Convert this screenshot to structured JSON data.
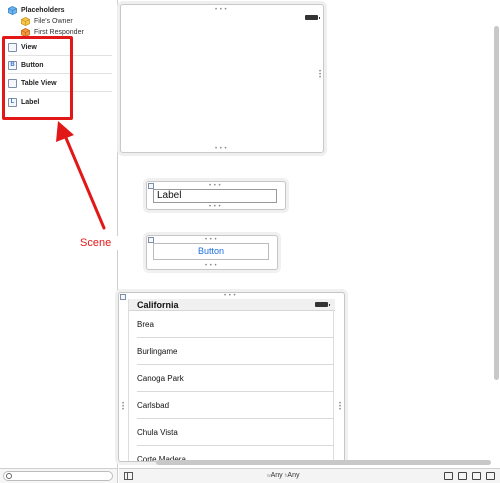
{
  "outline": {
    "placeholders_label": "Placeholders",
    "files_owner": "File's Owner",
    "first_responder": "First Responder",
    "scene_items": [
      {
        "label": "View",
        "icon": "view-icon",
        "glyph": ""
      },
      {
        "label": "Button",
        "icon": "button-icon",
        "glyph": "B"
      },
      {
        "label": "Table View",
        "icon": "table-view-icon",
        "glyph": ""
      },
      {
        "label": "Label",
        "icon": "label-icon",
        "glyph": "L"
      }
    ]
  },
  "annotation": {
    "caption": "Scene",
    "color": "#e21818"
  },
  "canvas": {
    "label_text": "Label",
    "button_text": "Button",
    "table": {
      "header": "California",
      "rows": [
        "Brea",
        "Burlingame",
        "Canoga Park",
        "Carlsbad",
        "Chula Vista",
        "Corte Madera"
      ]
    }
  },
  "toolbar": {
    "width_prefix": "w",
    "width_value": "Any",
    "height_prefix": "h",
    "height_value": "Any"
  }
}
